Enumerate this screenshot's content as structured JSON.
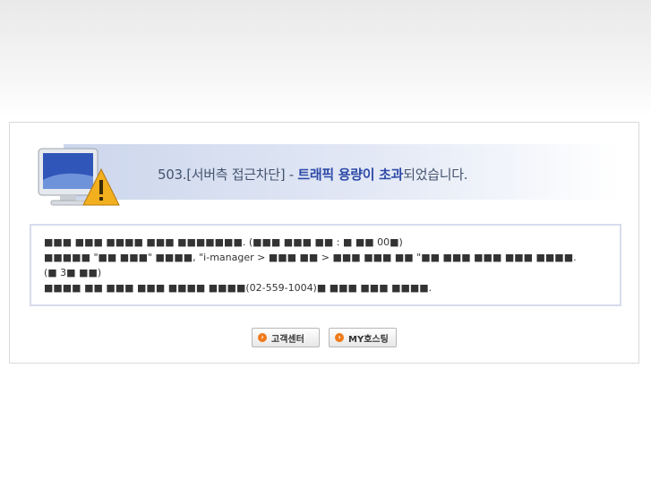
{
  "error": {
    "title_code": "503.",
    "title_bracket": "[서버측 접근차단] - ",
    "title_highlight": "트래픽 용량이 초과",
    "title_tail": "되었습니다."
  },
  "message": {
    "line1": "■■■ ■■■ ■■■■ ■■■ ■■■■■■■. (■■■ ■■■ ■■ : ■ ■■ 00■)",
    "line2": "■■■■■ \"■■ ■■■\" ■■■■, \"i-manager > ■■■ ■■ > ■■■ ■■■ ■■ \"■■ ■■■ ■■■ ■■■ ■■■■.",
    "line3": "(■ 3■ ■■)",
    "line4": "■■■■ ■■ ■■■ ■■■ ■■■■ ■■■■(02-559-1004)■ ■■■ ■■■ ■■■■."
  },
  "buttons": {
    "customer_center": "고객센터",
    "my_hosting": "MY호스팅"
  },
  "colors": {
    "title_highlight": "#2e4aa7",
    "button_icon": "#ef7a1a"
  },
  "icons": {
    "error_icon": "monitor-warning-icon",
    "button_icon": "orange-arrow-icon"
  }
}
